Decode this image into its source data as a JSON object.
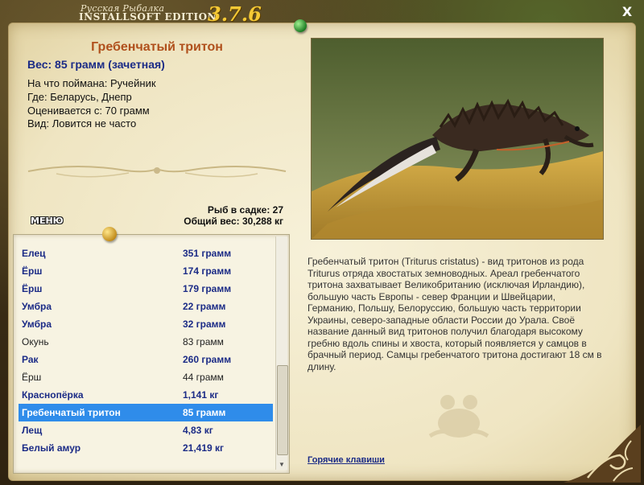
{
  "titlebar": {
    "small": "Русская Рыбалка",
    "main": "INSTALLSOFT EDITION",
    "version": "3.7.6",
    "close_label": "X"
  },
  "fish": {
    "name": "Гребенчатый тритон",
    "weight": "Вес: 85 грамм (зачетная)",
    "bait": "На что поймана: Ручейник",
    "location": "Где: Беларусь, Днепр",
    "rated": "Оценивается с: 70 грамм",
    "frequency": "Вид: Ловится не часто"
  },
  "stats": {
    "count": "Рыб в садке: 27",
    "total_weight": "Общий вес: 30,288 кг"
  },
  "menu_label": "МЕНЮ",
  "catch_list": [
    {
      "name": "Елец",
      "weight": "351 грамм",
      "style": "bold"
    },
    {
      "name": "Ёрш",
      "weight": "174 грамм",
      "style": "bold"
    },
    {
      "name": "Ёрш",
      "weight": "179 грамм",
      "style": "bold"
    },
    {
      "name": "Умбра",
      "weight": "22 грамм",
      "style": "bold"
    },
    {
      "name": "Умбра",
      "weight": "32 грамм",
      "style": "bold"
    },
    {
      "name": "Окунь",
      "weight": "83 грамм",
      "style": "plain"
    },
    {
      "name": "Рак",
      "weight": "260 грамм",
      "style": "bold"
    },
    {
      "name": "Ёрш",
      "weight": "44 грамм",
      "style": "plain"
    },
    {
      "name": "Краснопёрка",
      "weight": "1,141 кг",
      "style": "bold"
    },
    {
      "name": "Гребенчатый тритон",
      "weight": "85 грамм",
      "style": "sel"
    },
    {
      "name": "Лещ",
      "weight": "4,83 кг",
      "style": "bold"
    },
    {
      "name": "Белый амур",
      "weight": "21,419 кг",
      "style": "bold"
    }
  ],
  "description": "Гребенчатый тритон (Triturus cristatus) - вид тритонов из рода Triturus отряда хвостатых земноводных. Ареал гребенчатого тритона захватывает Великобританию (исключая Ирландию), большую часть Европы - север Франции и Швейцарии, Германию, Польшу, Белоруссию, большую часть территории Украины, северо-западные области России до Урала. Своё название данный вид тритонов получил благодаря высокому гребню вдоль спины и хвоста, который появляется у самцов в брачный период. Самцы гребенчатого тритона достигают 18 см в длину.",
  "hotkeys_label": "Горячие клавиши",
  "colors": {
    "title_version": "#f5c935",
    "fish_name": "#b0501c",
    "link_blue": "#1b2b86",
    "selection": "#2f8cea",
    "parchment": "#efe5c2"
  }
}
